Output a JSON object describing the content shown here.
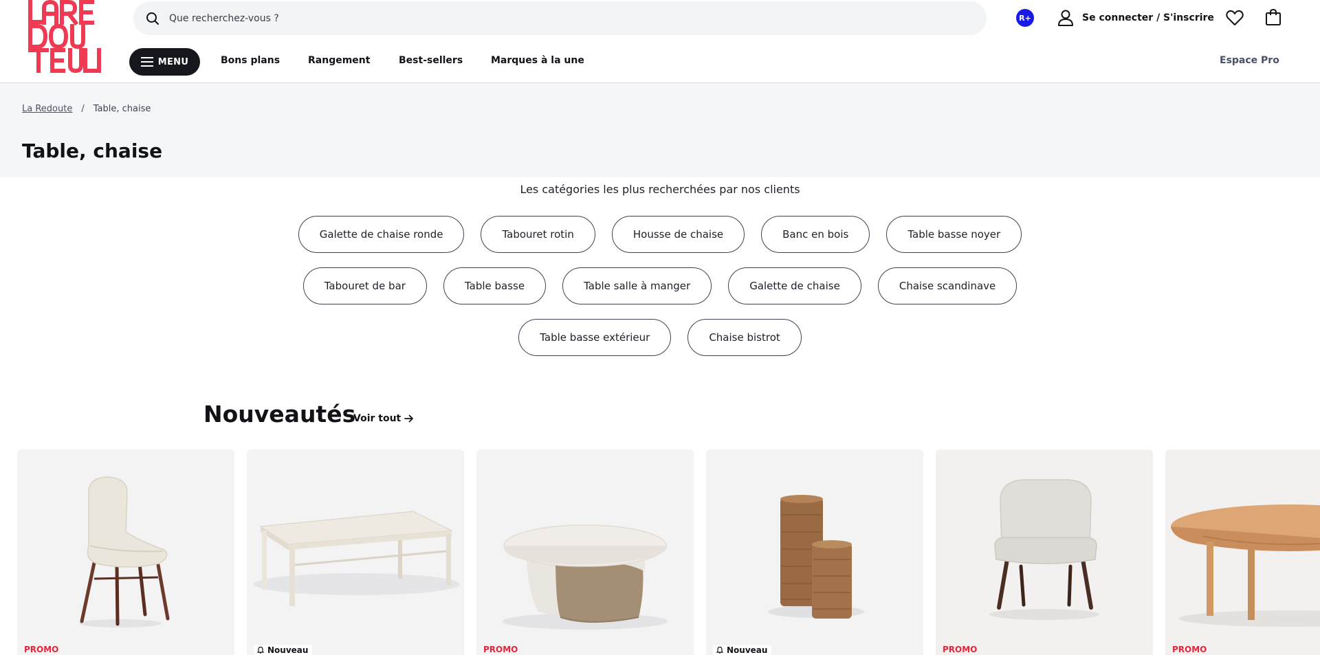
{
  "brand": {
    "logo_text": "LA REDOUTE",
    "color": "#f03a53"
  },
  "search": {
    "placeholder": "Que recherchez-vous ?"
  },
  "header": {
    "rplus_label": "R+",
    "account_label": "Se connecter / S'inscrire"
  },
  "nav": {
    "menu_label": "MENU",
    "links": [
      "Bons plans",
      "Rangement",
      "Best-sellers",
      "Marques à la une"
    ],
    "espace_pro": "Espace Pro"
  },
  "breadcrumb": {
    "home": "La Redoute",
    "separator": "/",
    "current": "Table, chaise"
  },
  "page_title": "Table, chaise",
  "popular": {
    "title": "Les catégories les plus recherchées par nos clients",
    "rows": [
      [
        "Galette de chaise ronde",
        "Tabouret rotin",
        "Housse de chaise",
        "Banc en bois",
        "Table basse noyer"
      ],
      [
        "Tabouret de bar",
        "Table basse",
        "Table salle à manger",
        "Galette de chaise",
        "Chaise scandinave"
      ],
      [
        "Table basse extérieur",
        "Chaise bistrot"
      ]
    ]
  },
  "new_arrivals": {
    "title": "Nouveautés",
    "see_all": "Voir tout",
    "products": [
      {
        "badge": "PROMO",
        "badge_type": "promo",
        "icon": "bouclette-chair"
      },
      {
        "badge": "Nouveau",
        "badge_type": "new",
        "icon": "white-table"
      },
      {
        "badge": "PROMO",
        "badge_type": "promo",
        "icon": "round-coffee-table"
      },
      {
        "badge": "Nouveau",
        "badge_type": "new",
        "icon": "rattan-stools"
      },
      {
        "badge": "PROMO",
        "badge_type": "promo",
        "icon": "upholstered-chair"
      },
      {
        "badge": "PROMO",
        "badge_type": "promo",
        "icon": "round-wood-table"
      }
    ]
  },
  "colors": {
    "accent_dark": "#15171c",
    "promo": "#e1263b",
    "band": "#f5f6f8",
    "rplus": "#1a1ae6"
  }
}
